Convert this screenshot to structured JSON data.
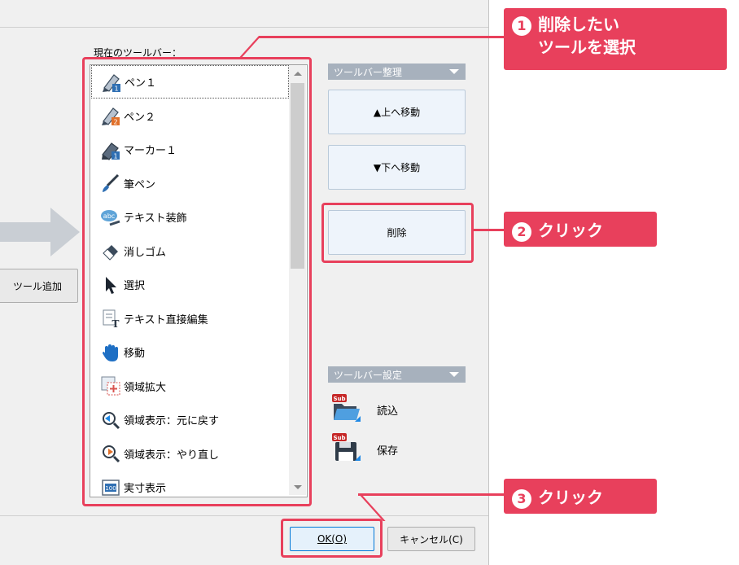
{
  "toolbar_label": "現在のツールバー：",
  "add_tool_button": "ツール追加",
  "toolbar_items": [
    {
      "label": "ペン１",
      "icon": "pen1-icon"
    },
    {
      "label": "ペン２",
      "icon": "pen2-icon"
    },
    {
      "label": "マーカー１",
      "icon": "marker1-icon"
    },
    {
      "label": "筆ペン",
      "icon": "brush-pen-icon"
    },
    {
      "label": "テキスト装飾",
      "icon": "text-decoration-icon"
    },
    {
      "label": "消しゴム",
      "icon": "eraser-icon"
    },
    {
      "label": "選択",
      "icon": "select-cursor-icon"
    },
    {
      "label": "テキスト直接編集",
      "icon": "text-edit-icon"
    },
    {
      "label": "移動",
      "icon": "hand-move-icon"
    },
    {
      "label": "領域拡大",
      "icon": "zoom-area-icon"
    },
    {
      "label": "領域表示：元に戻す",
      "icon": "view-undo-icon"
    },
    {
      "label": "領域表示：やり直し",
      "icon": "view-redo-icon"
    },
    {
      "label": "実寸表示",
      "icon": "actual-size-icon"
    }
  ],
  "organize": {
    "header": "ツールバー整理",
    "move_up": "▲上へ移動",
    "move_down": "▼下へ移動",
    "delete": "削除"
  },
  "settings": {
    "header": "ツールバー設定",
    "load": "読込",
    "save": "保存",
    "sub_badge": "Sub"
  },
  "footer": {
    "ok": "OK(O)",
    "cancel": "キャンセル(C)"
  },
  "callouts": {
    "step1_num": "1",
    "step1_line1": "削除したい",
    "step1_line2": "ツールを選択",
    "step2_num": "2",
    "step2_text": "クリック",
    "step3_num": "3",
    "step3_text": "クリック"
  },
  "colors": {
    "accent": "#e8405c",
    "header_bar": "#a7b1bd",
    "button_bg": "#eef4fb"
  }
}
